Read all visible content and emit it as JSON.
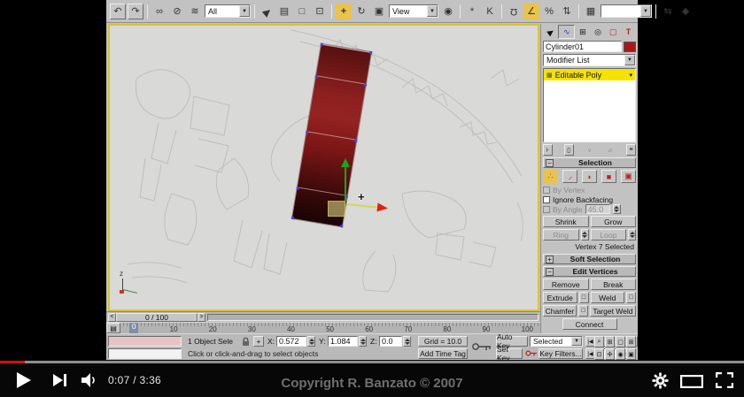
{
  "player": {
    "time": "0:07 / 3:36",
    "copyright": "Copyright R. Banzato © 2007",
    "progress_percent": 3.3,
    "colors": {
      "progress_red": "#d51007"
    }
  },
  "toolbar": {
    "selection_filter": "All",
    "ref_coord": "View",
    "named_sets": ""
  },
  "panel": {
    "object_name": "Cylinder01",
    "modifier_list": "Modifier List",
    "stack_item": "Editable Poly",
    "colors": {
      "object_swatch": "#a81818",
      "highlight": "#f6e200"
    },
    "selection": {
      "title": "Selection",
      "by_vertex": "By Vertex",
      "ignore_backfacing": "Ignore Backfacing",
      "by_angle": "By Angle",
      "by_angle_value": "45.0",
      "shrink": "Shrink",
      "grow": "Grow",
      "ring": "Ring",
      "loop": "Loop",
      "status": "Vertex 7 Selected"
    },
    "soft_selection_title": "Soft Selection",
    "edit_vertices": {
      "title": "Edit Vertices",
      "remove": "Remove",
      "break": "Break",
      "extrude": "Extrude",
      "weld": "Weld",
      "chamfer": "Chamfer",
      "target_weld": "Target Weld",
      "connect": "Connect"
    }
  },
  "timeline": {
    "slider": "0 / 100",
    "prev": "<",
    "next": ">",
    "ticks": [
      "0",
      "10",
      "20",
      "30",
      "40",
      "50",
      "60",
      "70",
      "80",
      "90",
      "100"
    ]
  },
  "status": {
    "selection": "1 Object Sele",
    "x_label": "X:",
    "x": "0.572",
    "y_label": "Y:",
    "y": "1.084",
    "z_label": "Z:",
    "z": "0.0",
    "grid": "Grid = 10.0",
    "add_time_tag": "Add Time Tag",
    "prompt": "Click or click-and-drag to select objects",
    "auto_key": "Auto Key",
    "set_key": "Set Key",
    "selected_dd": "Selected",
    "key_filters": "Key Filters...",
    "frame": "0"
  },
  "viewport": {
    "axis_label": "z"
  }
}
